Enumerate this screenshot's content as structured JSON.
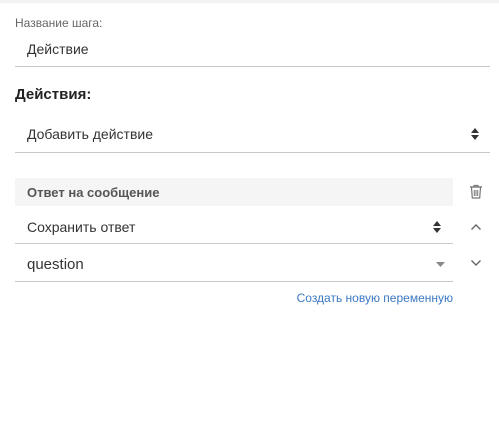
{
  "step": {
    "name_label": "Название шага:",
    "name_value": "Действие"
  },
  "actions": {
    "heading": "Действия:",
    "add_action_value": "Добавить действие"
  },
  "action_card": {
    "title": "Ответ на сообщение",
    "save_answer_value": "Сохранить ответ",
    "variable_value": "question",
    "create_variable_link": "Создать новую переменную"
  },
  "icons": {
    "sort": "sort-icon",
    "trash": "trash-icon",
    "move_up": "chevron-up-icon",
    "move_down": "chevron-down-icon",
    "dropdown": "caret-down-icon"
  },
  "colors": {
    "link": "#3b78c3",
    "card_header_bg": "#f5f5f5",
    "field_border": "#c8c8c8"
  }
}
